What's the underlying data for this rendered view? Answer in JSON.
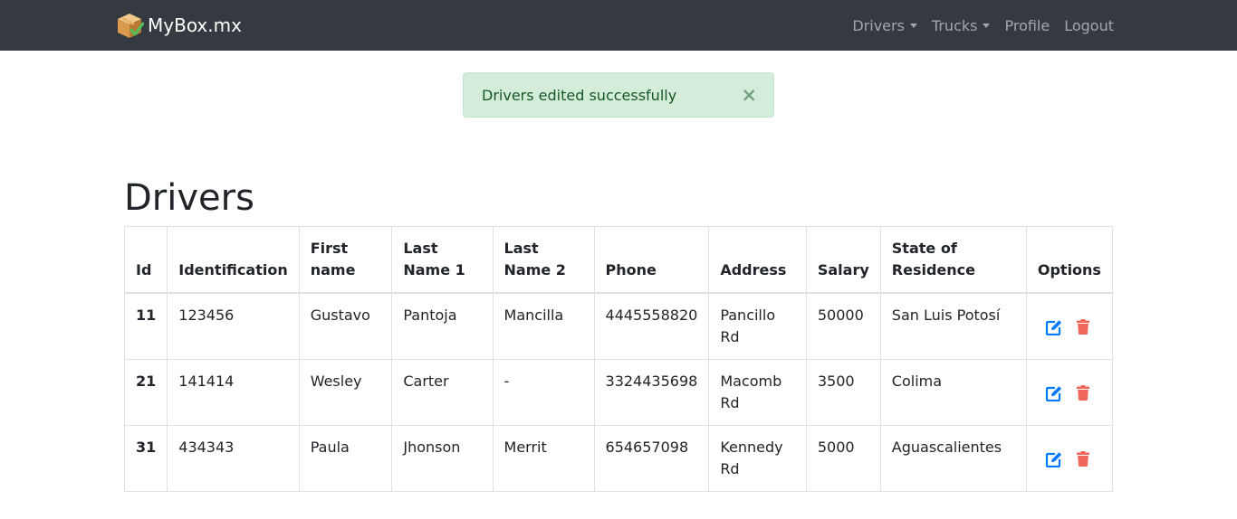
{
  "navbar": {
    "brand": "MyBox.mx",
    "brand_logo_icon": "box-check-icon",
    "items": [
      {
        "label": "Drivers",
        "dropdown": true
      },
      {
        "label": "Trucks",
        "dropdown": true
      },
      {
        "label": "Profile",
        "dropdown": false
      },
      {
        "label": "Logout",
        "dropdown": false
      }
    ]
  },
  "alert": {
    "message": "Drivers edited successfully",
    "close_symbol": "×"
  },
  "page": {
    "title": "Drivers"
  },
  "table": {
    "columns": [
      "Id",
      "Identification",
      "First name",
      "Last Name 1",
      "Last Name 2",
      "Phone",
      "Address",
      "Salary",
      "State of Residence",
      "Options"
    ],
    "rows": [
      {
        "id": "11",
        "identification": "123456",
        "first_name": "Gustavo",
        "last_name_1": "Pantoja",
        "last_name_2": "Mancilla",
        "phone": "4445558820",
        "address": "Pancillo Rd",
        "salary": "50000",
        "state": "San Luis Potosí"
      },
      {
        "id": "21",
        "identification": "141414",
        "first_name": "Wesley",
        "last_name_1": "Carter",
        "last_name_2": "-",
        "phone": "3324435698",
        "address": "Macomb Rd",
        "salary": "3500",
        "state": "Colima"
      },
      {
        "id": "31",
        "identification": "434343",
        "first_name": "Paula",
        "last_name_1": "Jhonson",
        "last_name_2": "Merrit",
        "phone": "654657098",
        "address": "Kennedy Rd",
        "salary": "5000",
        "state": "Aguascalientes"
      }
    ],
    "row_actions": [
      "edit-icon",
      "trash-icon"
    ]
  },
  "colors": {
    "navbar_bg": "#343a40",
    "alert_bg": "#d4edda",
    "alert_text": "#155724",
    "edit_icon": "#007bff",
    "delete_icon": "#f0665a"
  }
}
